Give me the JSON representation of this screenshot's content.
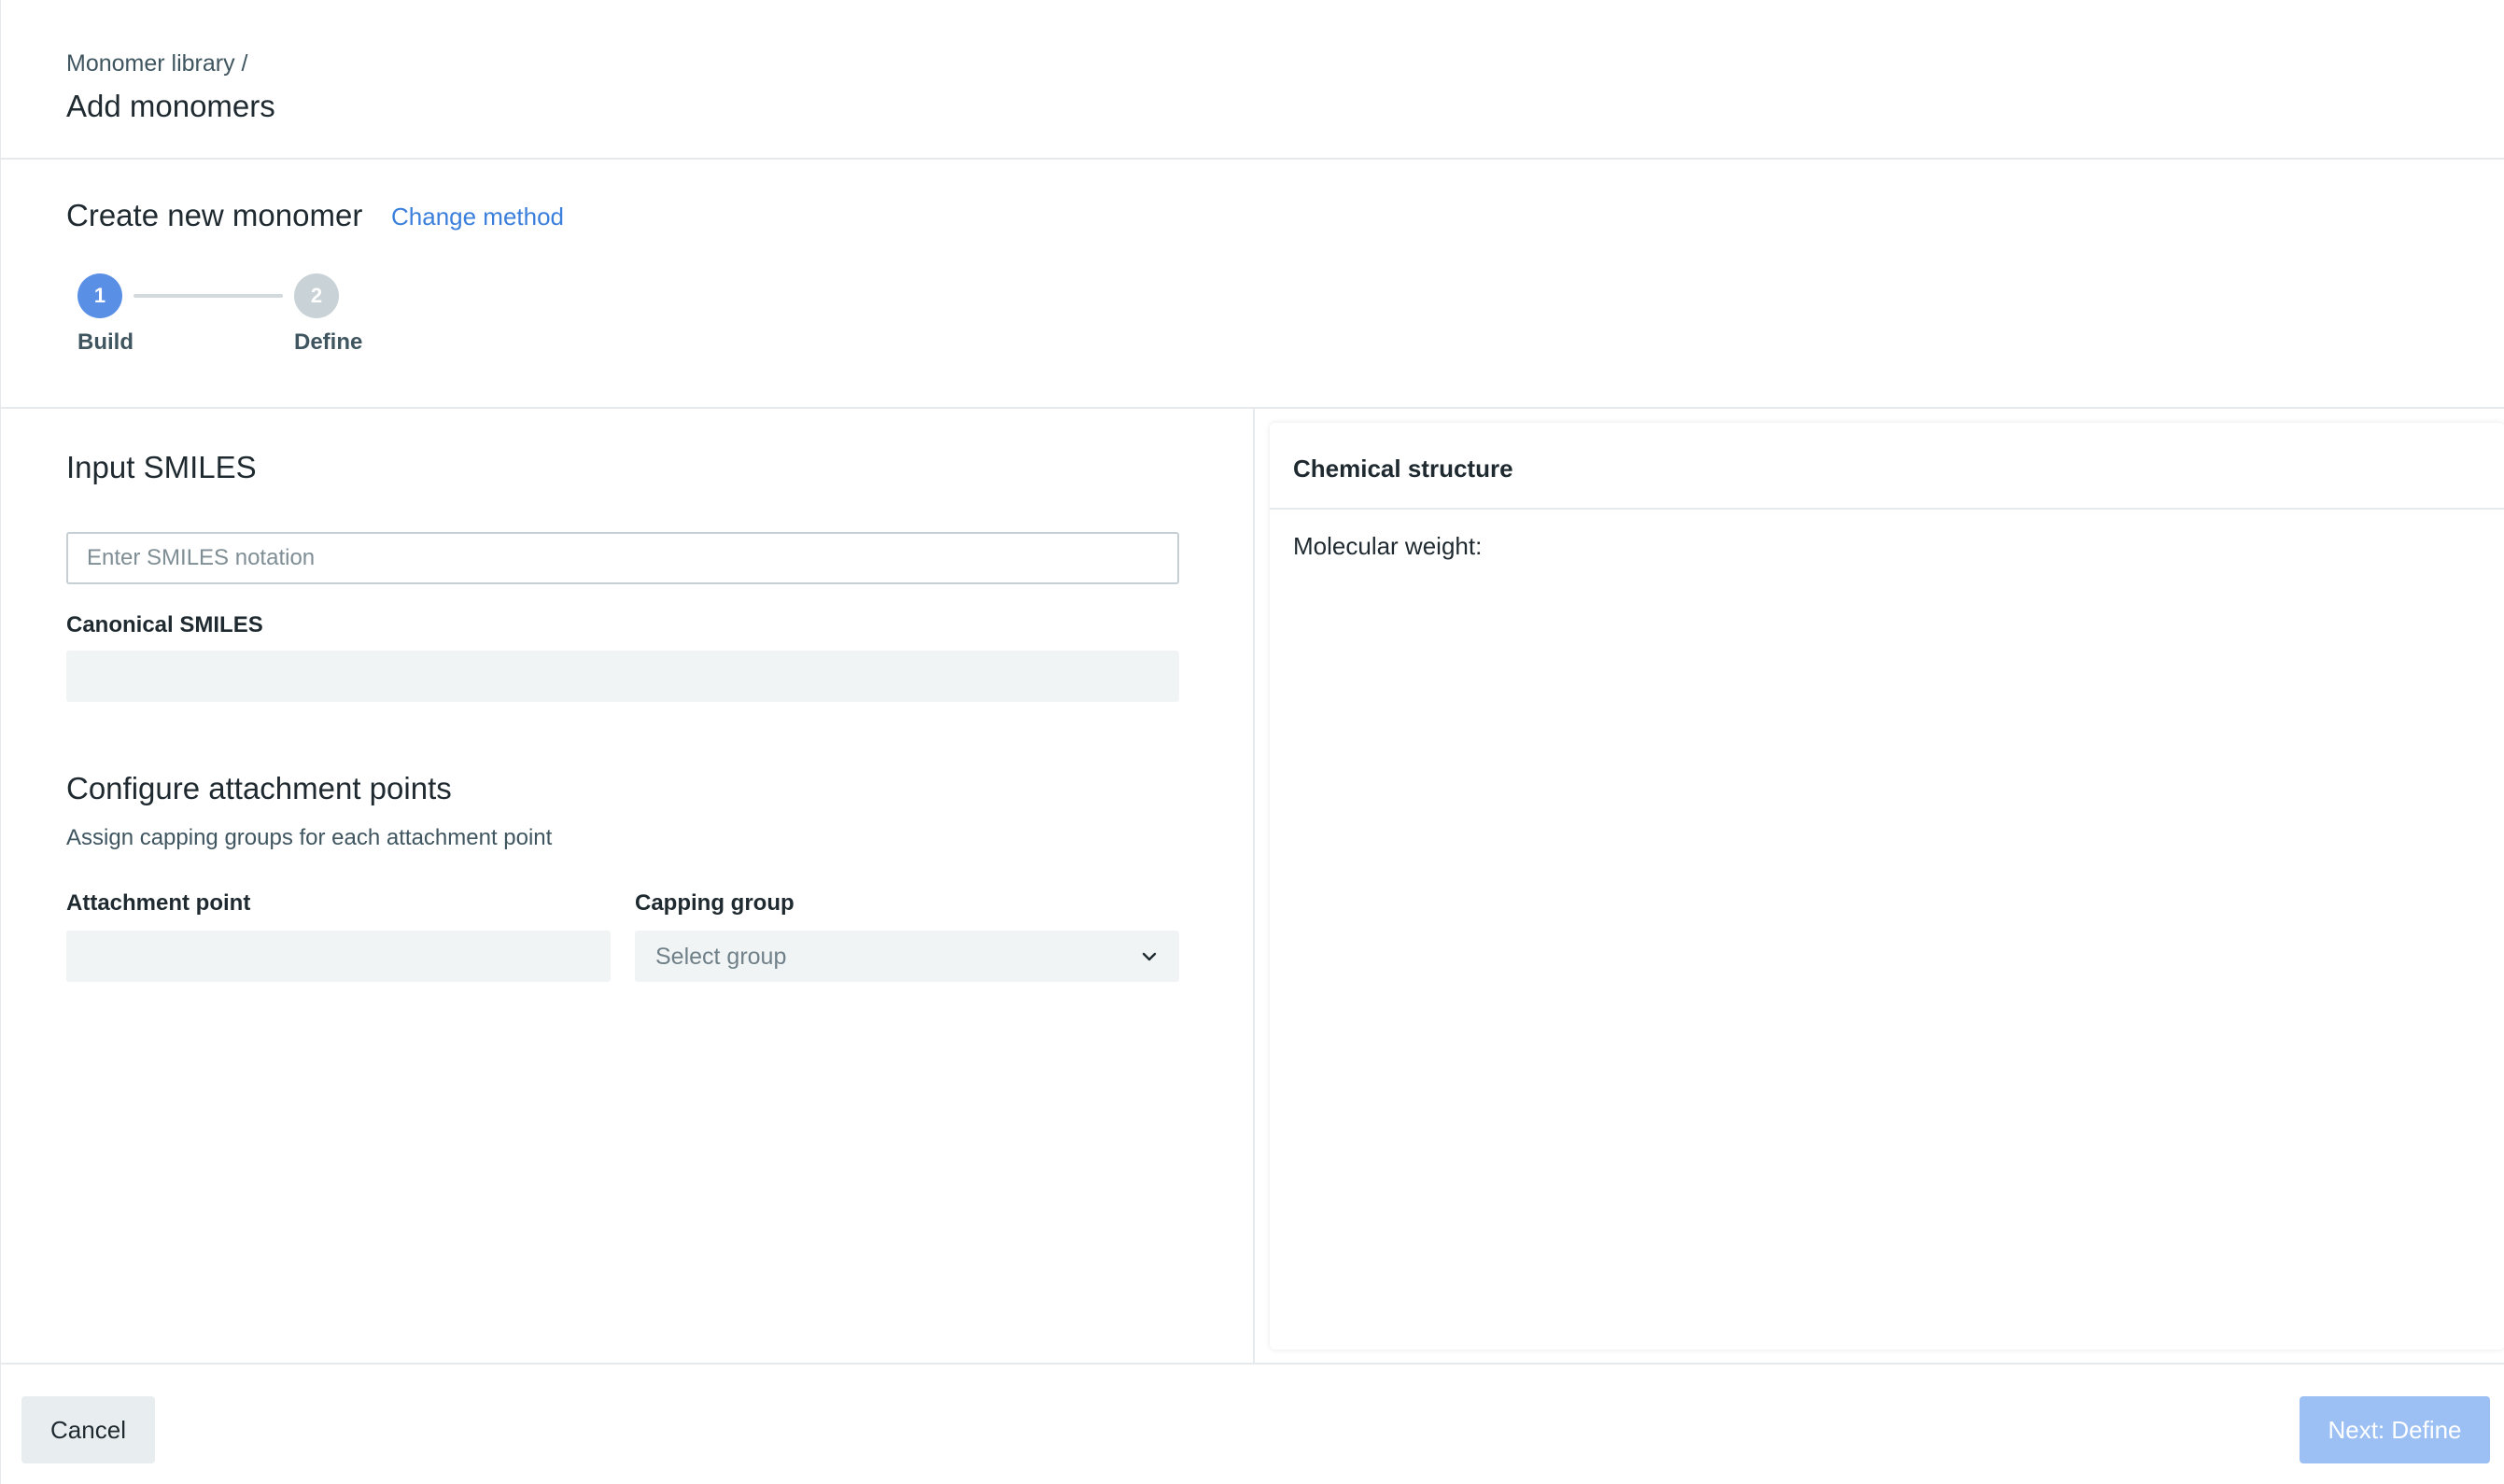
{
  "header": {
    "breadcrumb": "Monomer library /",
    "title": "Add monomers"
  },
  "method": {
    "title": "Create new monomer",
    "change_method_label": "Change method",
    "steps": [
      {
        "number": "1",
        "label": "Build",
        "state": "active"
      },
      {
        "number": "2",
        "label": "Define",
        "state": "inactive"
      }
    ]
  },
  "smiles": {
    "heading": "Input SMILES",
    "input_value": "",
    "input_placeholder": "Enter SMILES notation",
    "canonical_label": "Canonical SMILES",
    "canonical_value": ""
  },
  "attachment": {
    "heading": "Configure attachment points",
    "description": "Assign capping groups for each attachment point",
    "attachment_point_label": "Attachment point",
    "attachment_point_value": "",
    "capping_group_label": "Capping group",
    "capping_group_placeholder": "Select group"
  },
  "structure": {
    "title": "Chemical structure",
    "molecular_weight_label": "Molecular weight:",
    "molecular_weight_value": ""
  },
  "footer": {
    "cancel_label": "Cancel",
    "next_label": "Next: Define"
  },
  "colors": {
    "accent": "#5a8fe6",
    "link": "#3b7fdc",
    "primary_disabled": "#9cc0f3"
  },
  "icons": {
    "capping_select": "chevron-down-icon"
  }
}
